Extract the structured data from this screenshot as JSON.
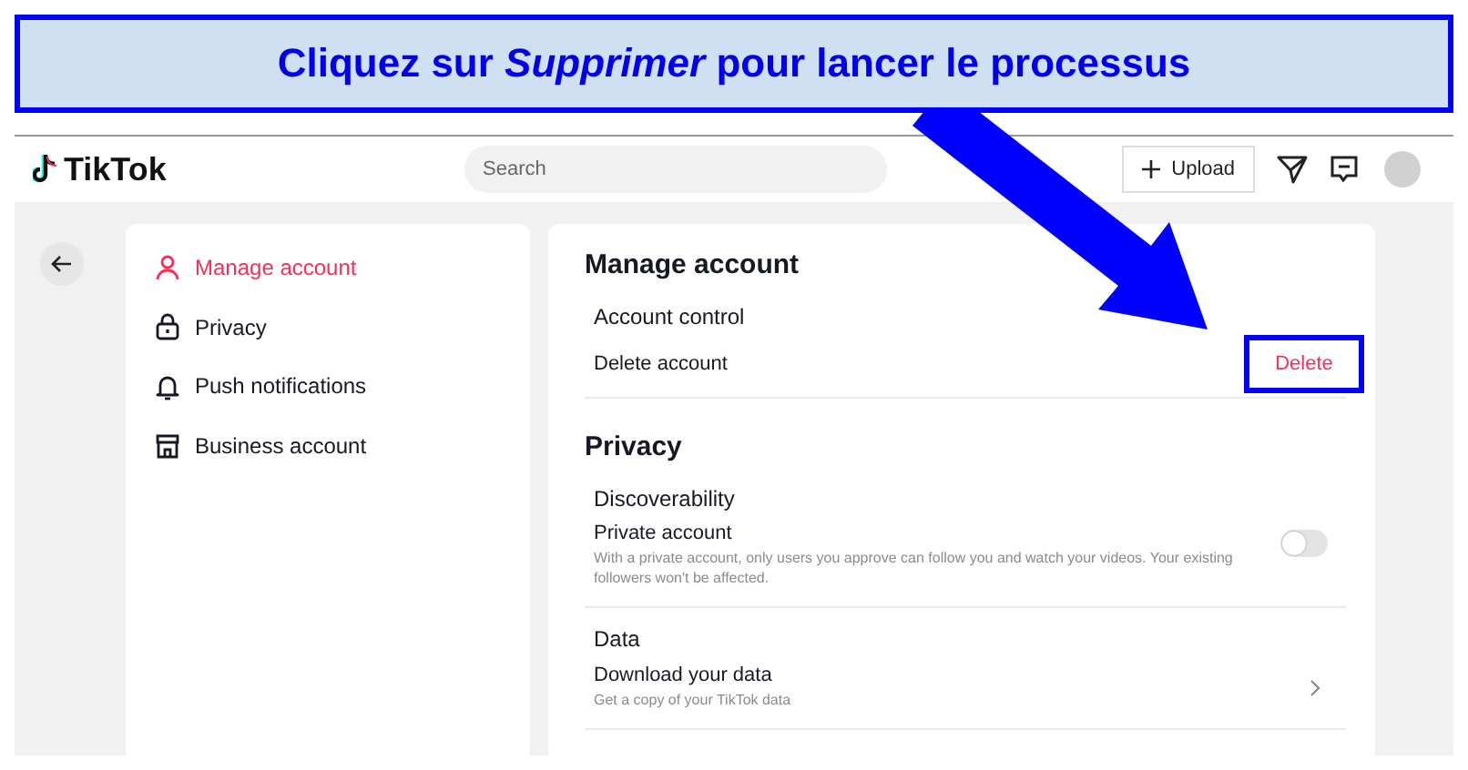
{
  "banner": {
    "text": "Cliquez sur *Supprimer* pour lancer le processus"
  },
  "header": {
    "logo": "TikTok",
    "search": {
      "placeholder": "Search"
    },
    "upload_button": "Upload"
  },
  "sidebar": {
    "items": [
      {
        "label": "Manage account",
        "selected": true
      },
      {
        "label": "Privacy",
        "selected": false
      },
      {
        "label": "Push notifications",
        "selected": false
      },
      {
        "label": "Business account",
        "selected": false
      }
    ]
  },
  "sections": [
    {
      "title": "Manage account",
      "groups": [
        {
          "title": "Account control",
          "rows": [
            {
              "kind": "button",
              "label": "Delete account",
              "action": "Delete",
              "highlighted": true
            }
          ]
        }
      ]
    },
    {
      "title": "Privacy",
      "groups": [
        {
          "title": "Discoverability",
          "rows": [
            {
              "kind": "toggle",
              "label": "Private account",
              "description": "With a private account, only users you approve can follow you and watch your videos. Your existing followers won't be affected.",
              "on": false
            }
          ]
        },
        {
          "title": "Data",
          "rows": [
            {
              "kind": "link",
              "label": "Download your data",
              "description": "Get a copy of your TikTok data"
            }
          ]
        }
      ]
    }
  ]
}
